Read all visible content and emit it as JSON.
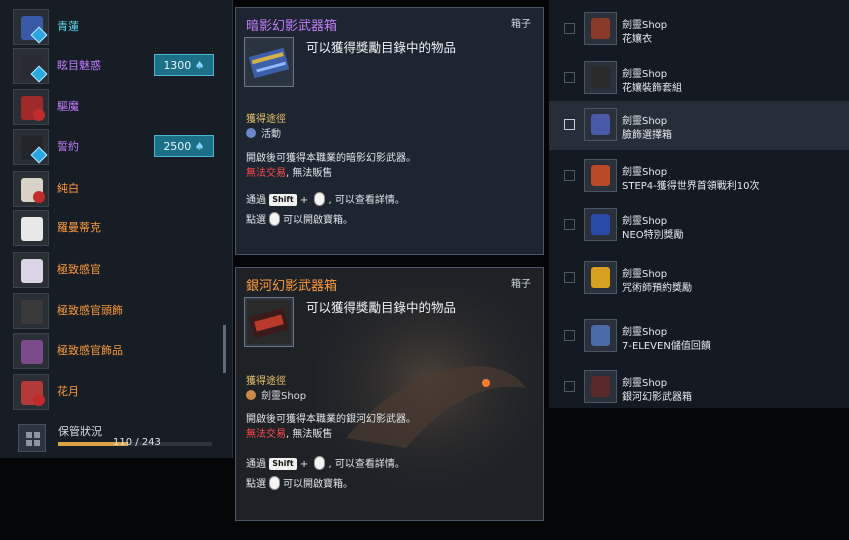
{
  "colors": {
    "rare": "#c27bff",
    "orange": "#ff9a3c",
    "cyan": "#5fd6e6",
    "gold": "#e8c46a",
    "red": "#ff4a4a",
    "price_bg": "#1c6f86"
  },
  "left_list": {
    "items": [
      {
        "name": "青蓮",
        "color": "#5fd6e6",
        "icon": "blue-coat-icon",
        "price": "",
        "badge": "diamond"
      },
      {
        "name": "眩目魅惑",
        "color": "#c27bff",
        "icon": "dark-outfit-icon",
        "price": "1300",
        "badge": "diamond"
      },
      {
        "name": "驅魔",
        "color": "#c27bff",
        "icon": "red-armor-icon",
        "price": "",
        "badge": "red"
      },
      {
        "name": "誓約",
        "color": "#c27bff",
        "icon": "black-suit-icon",
        "price": "2500",
        "badge": "diamond"
      },
      {
        "name": "純白",
        "color": "#ff9a3c",
        "icon": "white-outfit-icon",
        "price": "",
        "badge": "red"
      },
      {
        "name": "羅曼蒂克",
        "color": "#ff9a3c",
        "icon": "glasses-icon",
        "price": "",
        "badge": ""
      },
      {
        "name": "極致感官",
        "color": "#ff9a3c",
        "icon": "white-shirt-icon",
        "price": "",
        "badge": ""
      },
      {
        "name": "極致感官頭飾",
        "color": "#ff9a3c",
        "icon": "headpiece-icon",
        "price": "",
        "badge": ""
      },
      {
        "name": "極致感官飾品",
        "color": "#ff9a3c",
        "icon": "accessory-frame-icon",
        "price": "",
        "badge": ""
      },
      {
        "name": "花月",
        "color": "#ff9a3c",
        "icon": "floral-dress-icon",
        "price": "",
        "badge": "red"
      }
    ],
    "price_unit_icon": "diamond-icon"
  },
  "storage": {
    "label": "保管狀況",
    "count": "110 / 243",
    "fill": 0.453
  },
  "tooltips": [
    {
      "title": "暗影幻影武器箱",
      "title_color": "#c27bff",
      "category": "箱子",
      "description": "可以獲得獎勵目錄中的物品",
      "source_heading": "獲得途徑",
      "source": "活動",
      "source_icon": "event-icon",
      "line1": "開啟後可獲得本職業的暗影幻影武器。",
      "untradeable": "無法交易",
      "unsellable": ", 無法販售",
      "hint_prefix": "通過",
      "hint_key": "Shift",
      "hint_plus": "+",
      "hint_suffix": ", 可以查看詳情。",
      "open_prefix": "點選",
      "open_suffix": "可以開啟寶箱。"
    },
    {
      "title": "銀河幻影武器箱",
      "title_color": "#ff9a3c",
      "category": "箱子",
      "description": "可以獲得獎勵目錄中的物品",
      "source_heading": "獲得途徑",
      "source": "劍靈Shop",
      "source_icon": "shop-icon",
      "line1": "開啟後可獲得本職業的銀河幻影武器。",
      "untradeable": "無法交易",
      "unsellable": ", 無法販售",
      "hint_prefix": "通過",
      "hint_key": "Shift",
      "hint_plus": "+",
      "hint_suffix": ", 可以查看詳情。",
      "open_prefix": "點選",
      "open_suffix": "可以開啟寶箱。"
    }
  ],
  "right_list": {
    "shop_label": "劍靈Shop",
    "items": [
      {
        "name": "花孃衣",
        "icon": "red-robe-icon",
        "highlighted": false
      },
      {
        "name": "花孃裝飾套組",
        "icon": "fur-collar-icon",
        "highlighted": false
      },
      {
        "name": "臉飾選擇箱",
        "icon": "face-accessory-box-icon",
        "highlighted": true
      },
      {
        "name": "STEP4-獲得世界首領戰利10次",
        "icon": "red-armor-icon",
        "highlighted": false
      },
      {
        "name": "NEO特別獎勵",
        "icon": "blue-coat-icon",
        "highlighted": false
      },
      {
        "name": "咒術師預約獎勵",
        "icon": "gold-chest-icon",
        "highlighted": false
      },
      {
        "name": "7-ELEVEN儲值回饋",
        "icon": "shadow-weapon-box-icon",
        "highlighted": false
      },
      {
        "name": "銀河幻影武器箱",
        "icon": "galaxy-weapon-box-icon",
        "highlighted": false
      }
    ]
  }
}
